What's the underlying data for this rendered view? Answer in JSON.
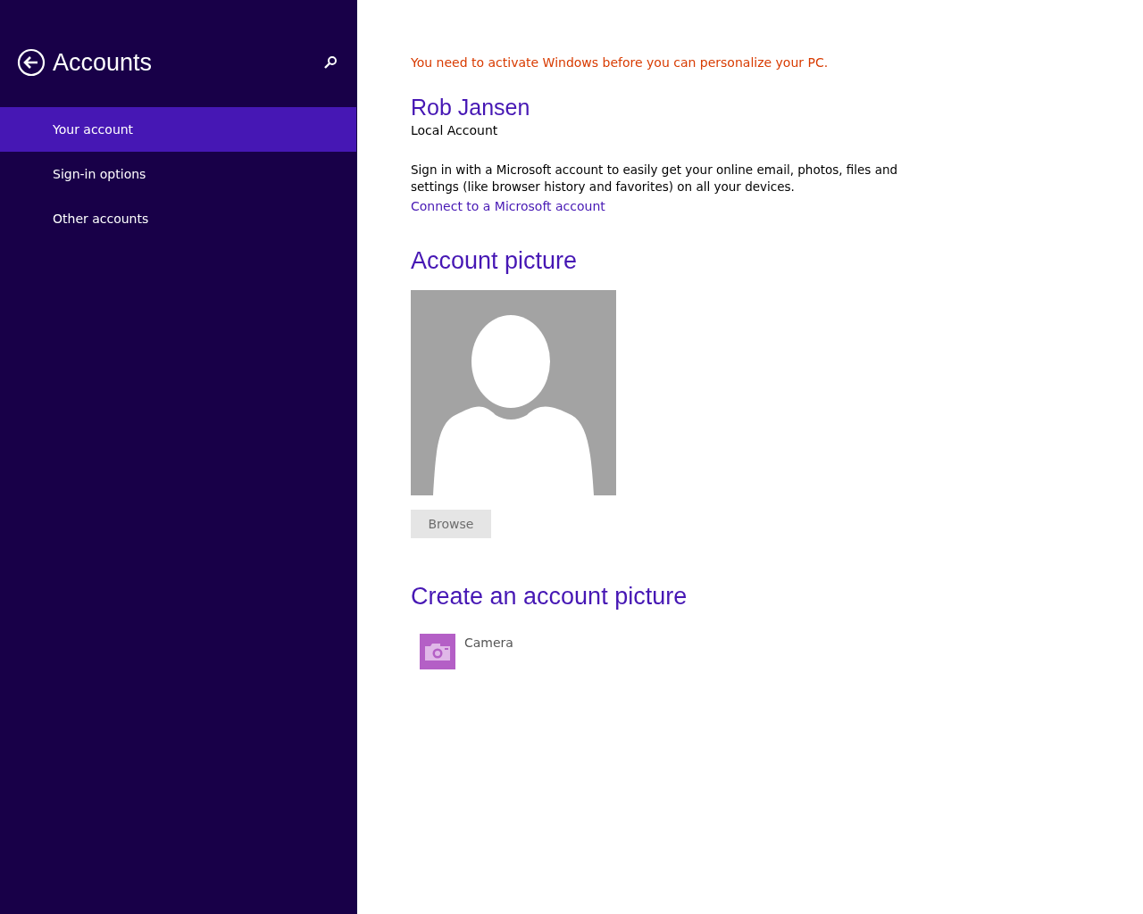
{
  "sidebar": {
    "title": "Accounts",
    "items": [
      {
        "label": "Your account",
        "selected": true
      },
      {
        "label": "Sign-in options",
        "selected": false
      },
      {
        "label": "Other accounts",
        "selected": false
      }
    ]
  },
  "main": {
    "warning": "You need to activate Windows before you can personalize your PC.",
    "user_name": "Rob Jansen",
    "account_type": "Local Account",
    "description": "Sign in with a Microsoft account to easily get your online email, photos, files and settings (like browser history and favorites) on all your devices.",
    "connect_link": "Connect to a Microsoft account",
    "picture_heading": "Account picture",
    "browse_button": {
      "label": "Browse",
      "disabled": true
    },
    "create_heading": "Create an account picture",
    "apps": [
      {
        "label": "Camera"
      }
    ]
  }
}
